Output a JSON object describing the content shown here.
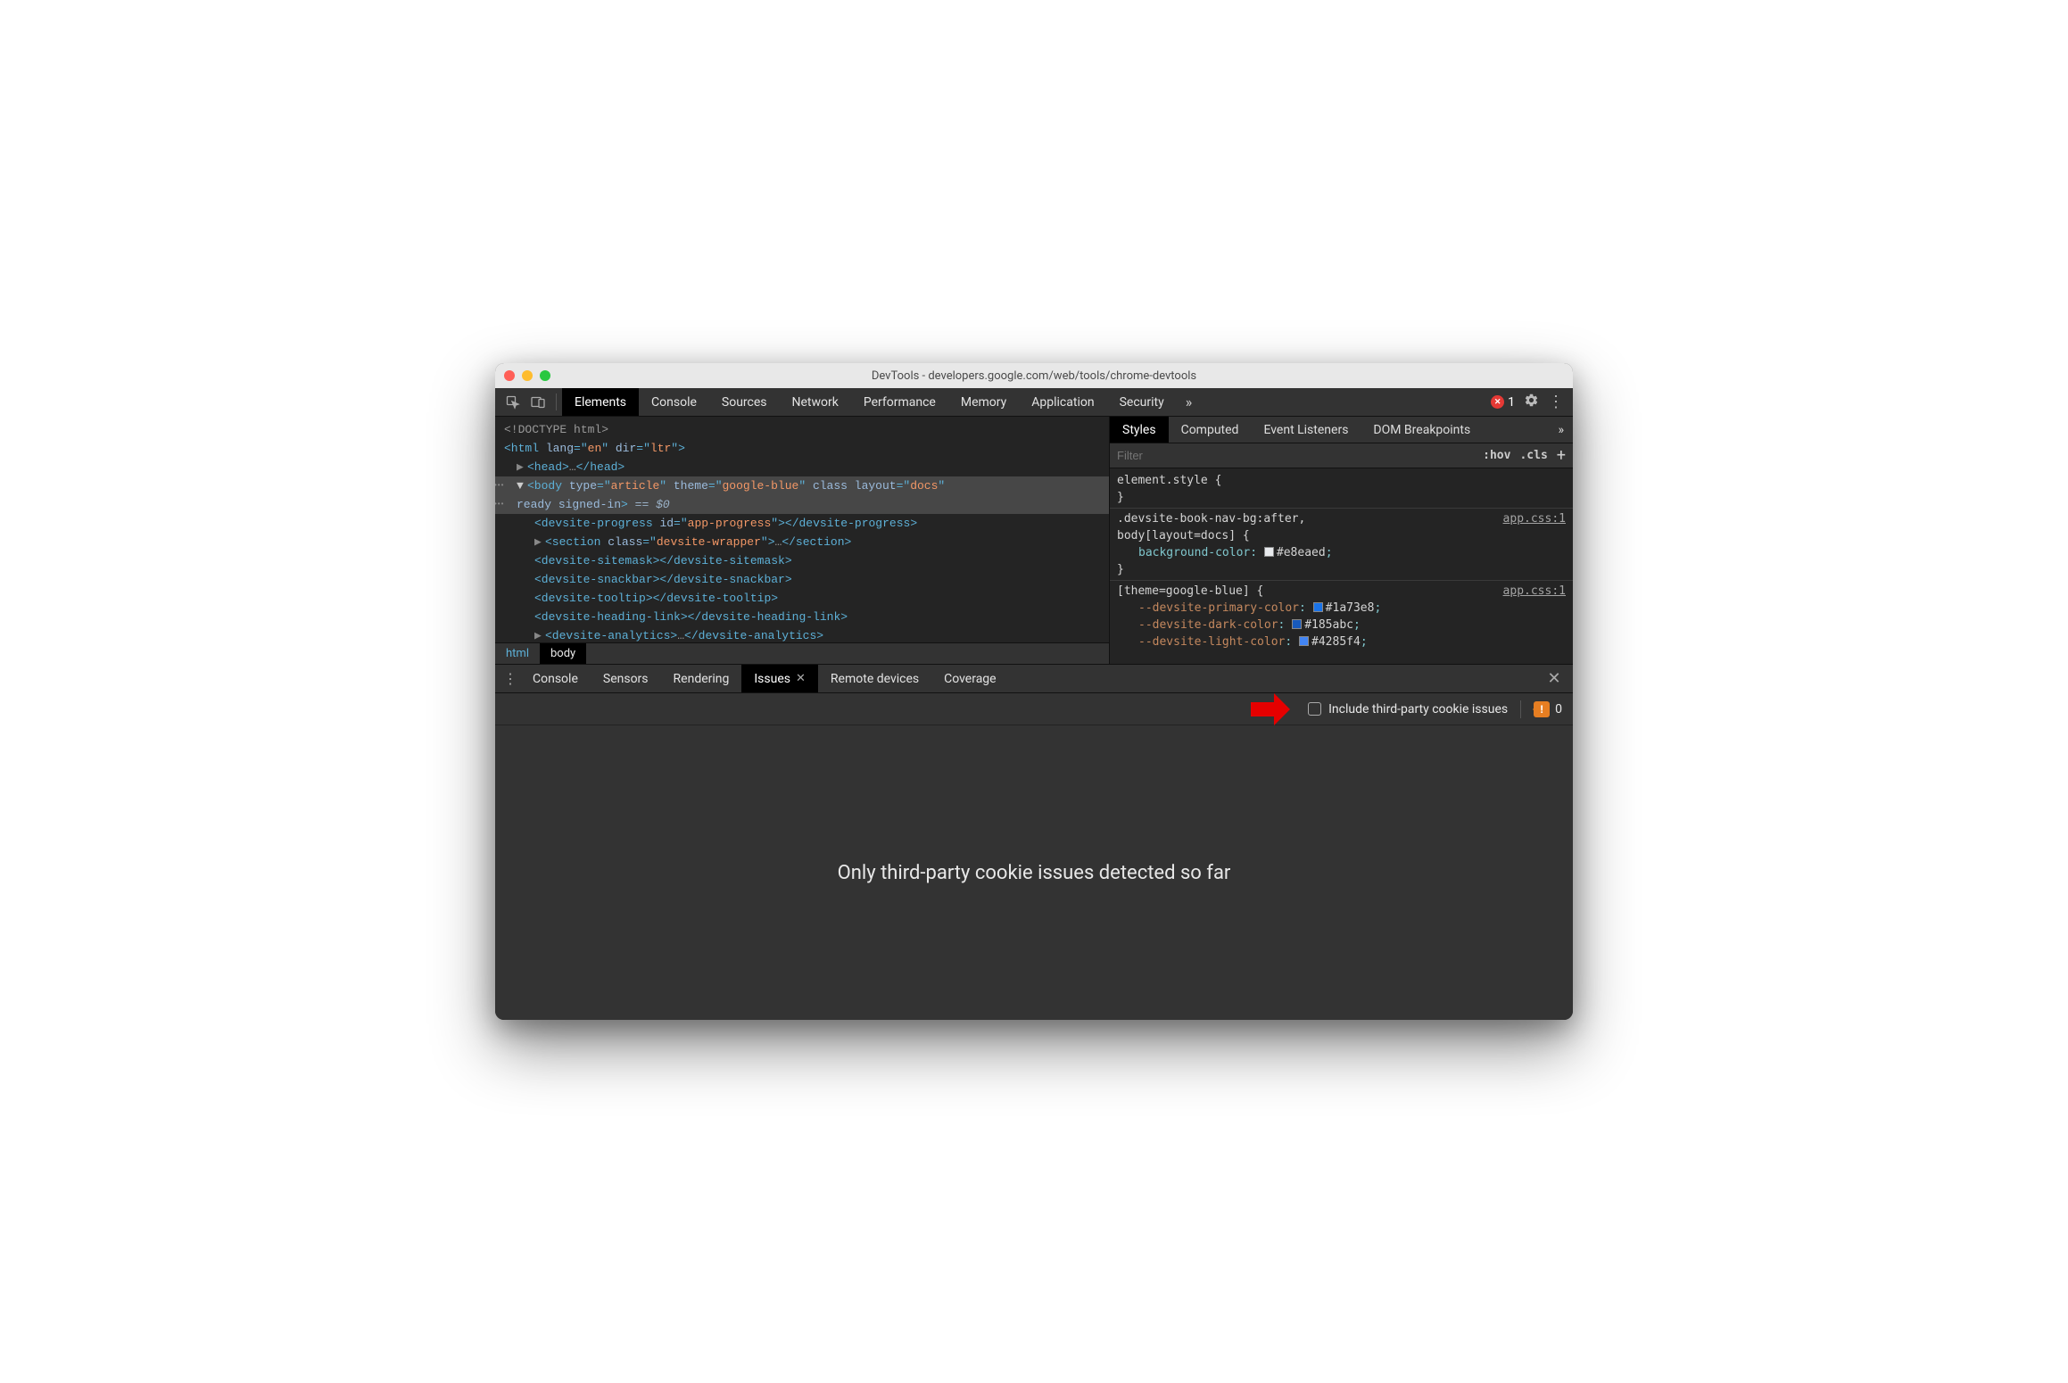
{
  "window": {
    "title": "DevTools - developers.google.com/web/tools/chrome-devtools"
  },
  "toolbar": {
    "tabs": [
      "Elements",
      "Console",
      "Sources",
      "Network",
      "Performance",
      "Memory",
      "Application",
      "Security"
    ],
    "active_tab": "Elements",
    "error_count": "1"
  },
  "dom": {
    "lines": {
      "doctype": "<!DOCTYPE html>",
      "html_open": "<html lang=\"en\" dir=\"ltr\">",
      "head": "<head>…</head>",
      "body_attrs_type": "article",
      "body_attrs_theme": "google-blue",
      "body_attrs_layout": "docs",
      "body_line2": "ready signed-in>",
      "eq": " == $0",
      "devsite_progress_id": "app-progress",
      "section_class": "devsite-wrapper"
    },
    "breadcrumb": [
      "html",
      "body"
    ]
  },
  "styles": {
    "tabs": [
      "Styles",
      "Computed",
      "Event Listeners",
      "DOM Breakpoints"
    ],
    "active_tab": "Styles",
    "filter_placeholder": "Filter",
    "hov": ":hov",
    "cls": ".cls",
    "rules": {
      "r0_sel": "element.style {",
      "r0_close": "}",
      "r1_sel1": ".devsite-book-nav-bg:after,",
      "r1_sel2": "body[layout=docs] {",
      "r1_link": "app.css:1",
      "r1_prop": "background-color",
      "r1_val": "#e8eaed",
      "r1_swatch": "#e8eaed",
      "r2_sel": "[theme=google-blue] {",
      "r2_link": "app.css:1",
      "r2_p1": "--devsite-primary-color",
      "r2_v1": "#1a73e8",
      "r2_p2": "--devsite-dark-color",
      "r2_v2": "#185abc",
      "r2_p3": "--devsite-light-color",
      "r2_v3": "#4285f4"
    }
  },
  "drawer": {
    "tabs": [
      "Console",
      "Sensors",
      "Rendering",
      "Issues",
      "Remote devices",
      "Coverage"
    ],
    "active_tab": "Issues"
  },
  "issues": {
    "checkbox_label": "Include third-party cookie issues",
    "badge_count": "0",
    "body_text": "Only third-party cookie issues detected so far"
  }
}
